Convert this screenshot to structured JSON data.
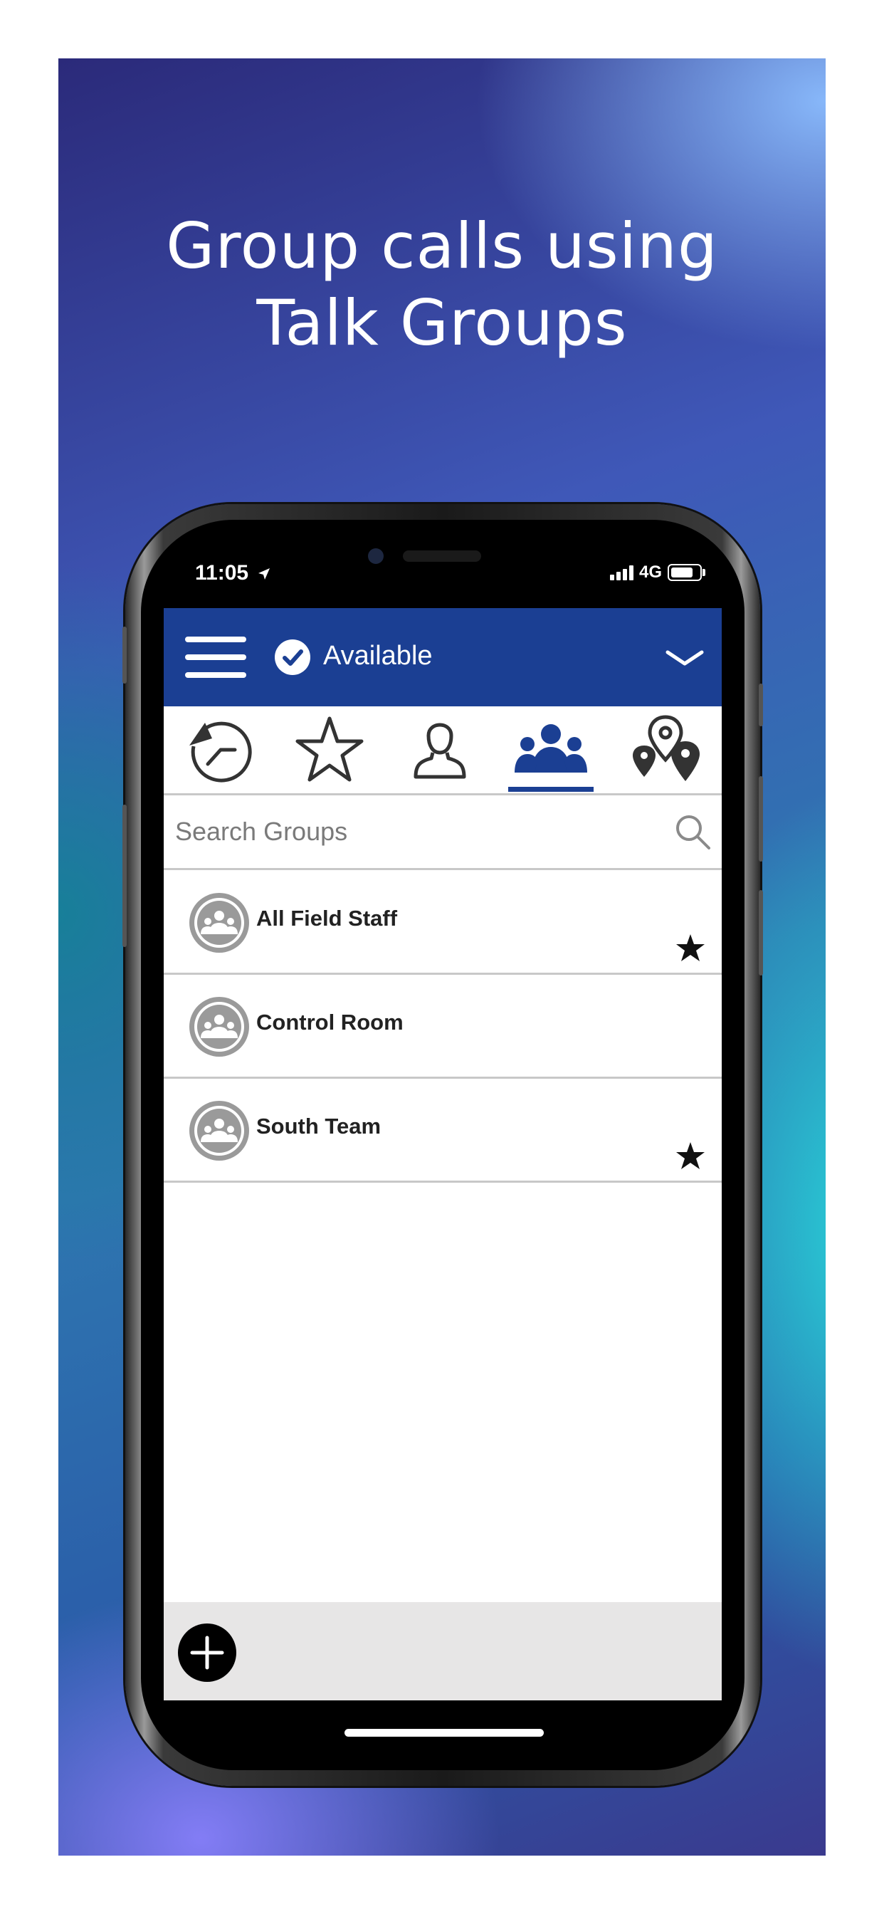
{
  "headline": {
    "line1": "Group calls using",
    "line2": "Talk Groups"
  },
  "status_bar": {
    "time": "11:05",
    "network": "4G"
  },
  "app_header": {
    "status_label": "Available"
  },
  "tabs": [
    {
      "icon": "history-icon"
    },
    {
      "icon": "star-icon"
    },
    {
      "icon": "contact-icon"
    },
    {
      "icon": "groups-icon",
      "selected": true
    },
    {
      "icon": "map-pins-icon"
    }
  ],
  "search": {
    "placeholder": "Search Groups"
  },
  "groups": [
    {
      "name": "All Field Staff",
      "favorite": true
    },
    {
      "name": "Control Room",
      "favorite": false
    },
    {
      "name": "South Team",
      "favorite": true
    }
  ],
  "colors": {
    "header_blue": "#1b3f93",
    "footer_gray": "#e7e6e6",
    "avatar_gray": "#9a9a9a"
  }
}
